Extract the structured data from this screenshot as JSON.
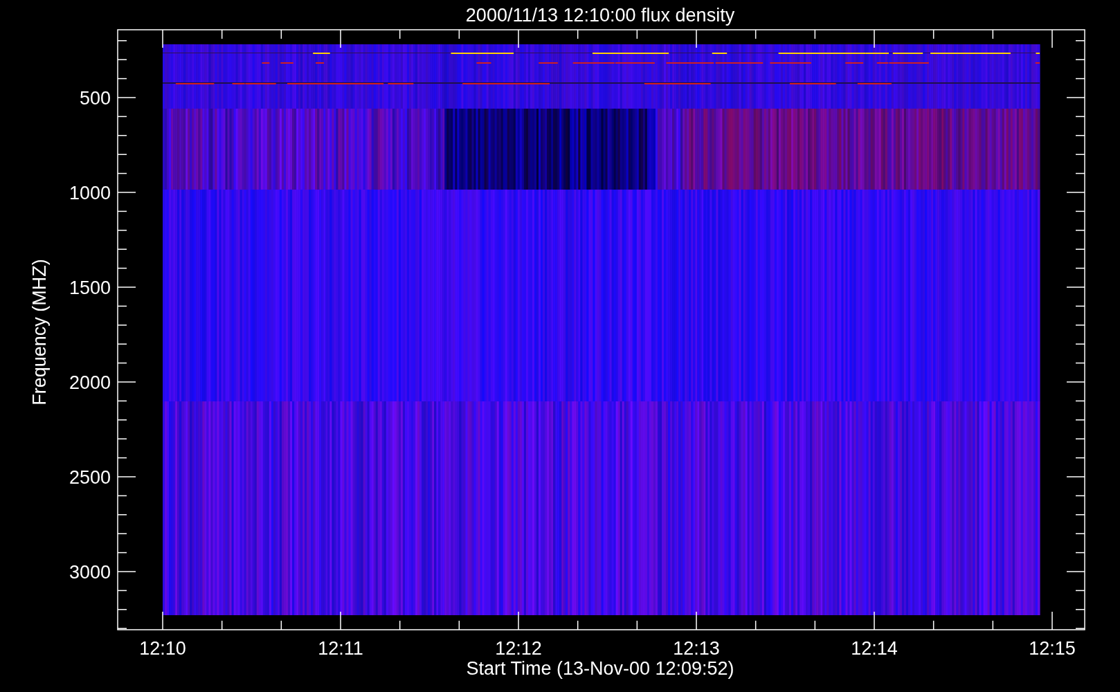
{
  "plot": {
    "title": "2000/11/13 12:10:00 flux density",
    "ylabel": "Frequency (MHZ)",
    "xlabel": "Start Time (13-Nov-00 12:09:52)",
    "yticks": [
      "500",
      "1000",
      "1500",
      "2000",
      "2500",
      "3000"
    ],
    "xticks": [
      "12:10",
      "12:11",
      "12:12",
      "12:13",
      "12:14",
      "12:15"
    ]
  }
}
